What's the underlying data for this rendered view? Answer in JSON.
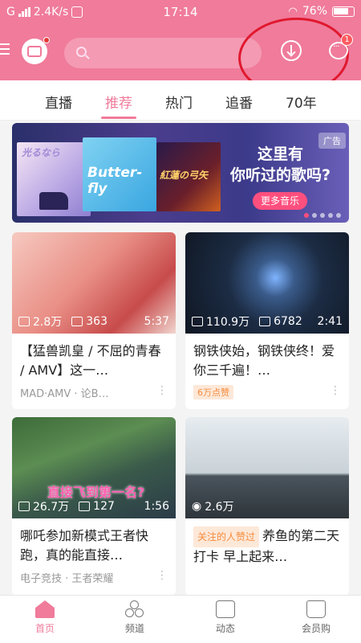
{
  "status_bar": {
    "carrier": "G",
    "speed": "2.4K/s",
    "time": "17:14",
    "battery": "76%"
  },
  "header": {
    "notification_count": "1"
  },
  "tabs": [
    {
      "label": "直播"
    },
    {
      "label": "推荐"
    },
    {
      "label": "热门"
    },
    {
      "label": "追番"
    },
    {
      "label": "70年"
    }
  ],
  "banner": {
    "album_1_text": "光るなら",
    "album_2_text": "Butter-fly",
    "album_3_text": "紅蓮の弓矢",
    "title_line1": "这里有",
    "title_line2": "你听过的歌吗?",
    "button": "更多音乐",
    "ad_label": "广告"
  },
  "cards": [
    {
      "views": "2.8万",
      "danmaku": "363",
      "duration": "5:37",
      "title": "【猛兽凯皇 / 不屈的青春 / AMV】这一…",
      "meta": "MAD·AMV · 论B…"
    },
    {
      "views": "110.9万",
      "danmaku": "6782",
      "duration": "2:41",
      "title": "钢铁侠始，钢铁侠终！爱你三千遍！…",
      "badge": "6万点赞"
    },
    {
      "views": "26.7万",
      "danmaku": "127",
      "duration": "1:56",
      "overlay": "直接飞到第一名?",
      "title": "哪吒参加新模式王者快跑，真的能直接…",
      "meta": "电子竞技 · 王者荣耀"
    },
    {
      "views": "2.6万",
      "badge": "关注的人赞过",
      "title": "养鱼的第二天 打卡 早上起来…"
    }
  ],
  "bottom_nav": [
    {
      "label": "首页"
    },
    {
      "label": "频道"
    },
    {
      "label": "动态"
    },
    {
      "label": "会员购"
    }
  ],
  "colors": {
    "accent": "#f07b9b",
    "annotation": "#e0182e"
  }
}
